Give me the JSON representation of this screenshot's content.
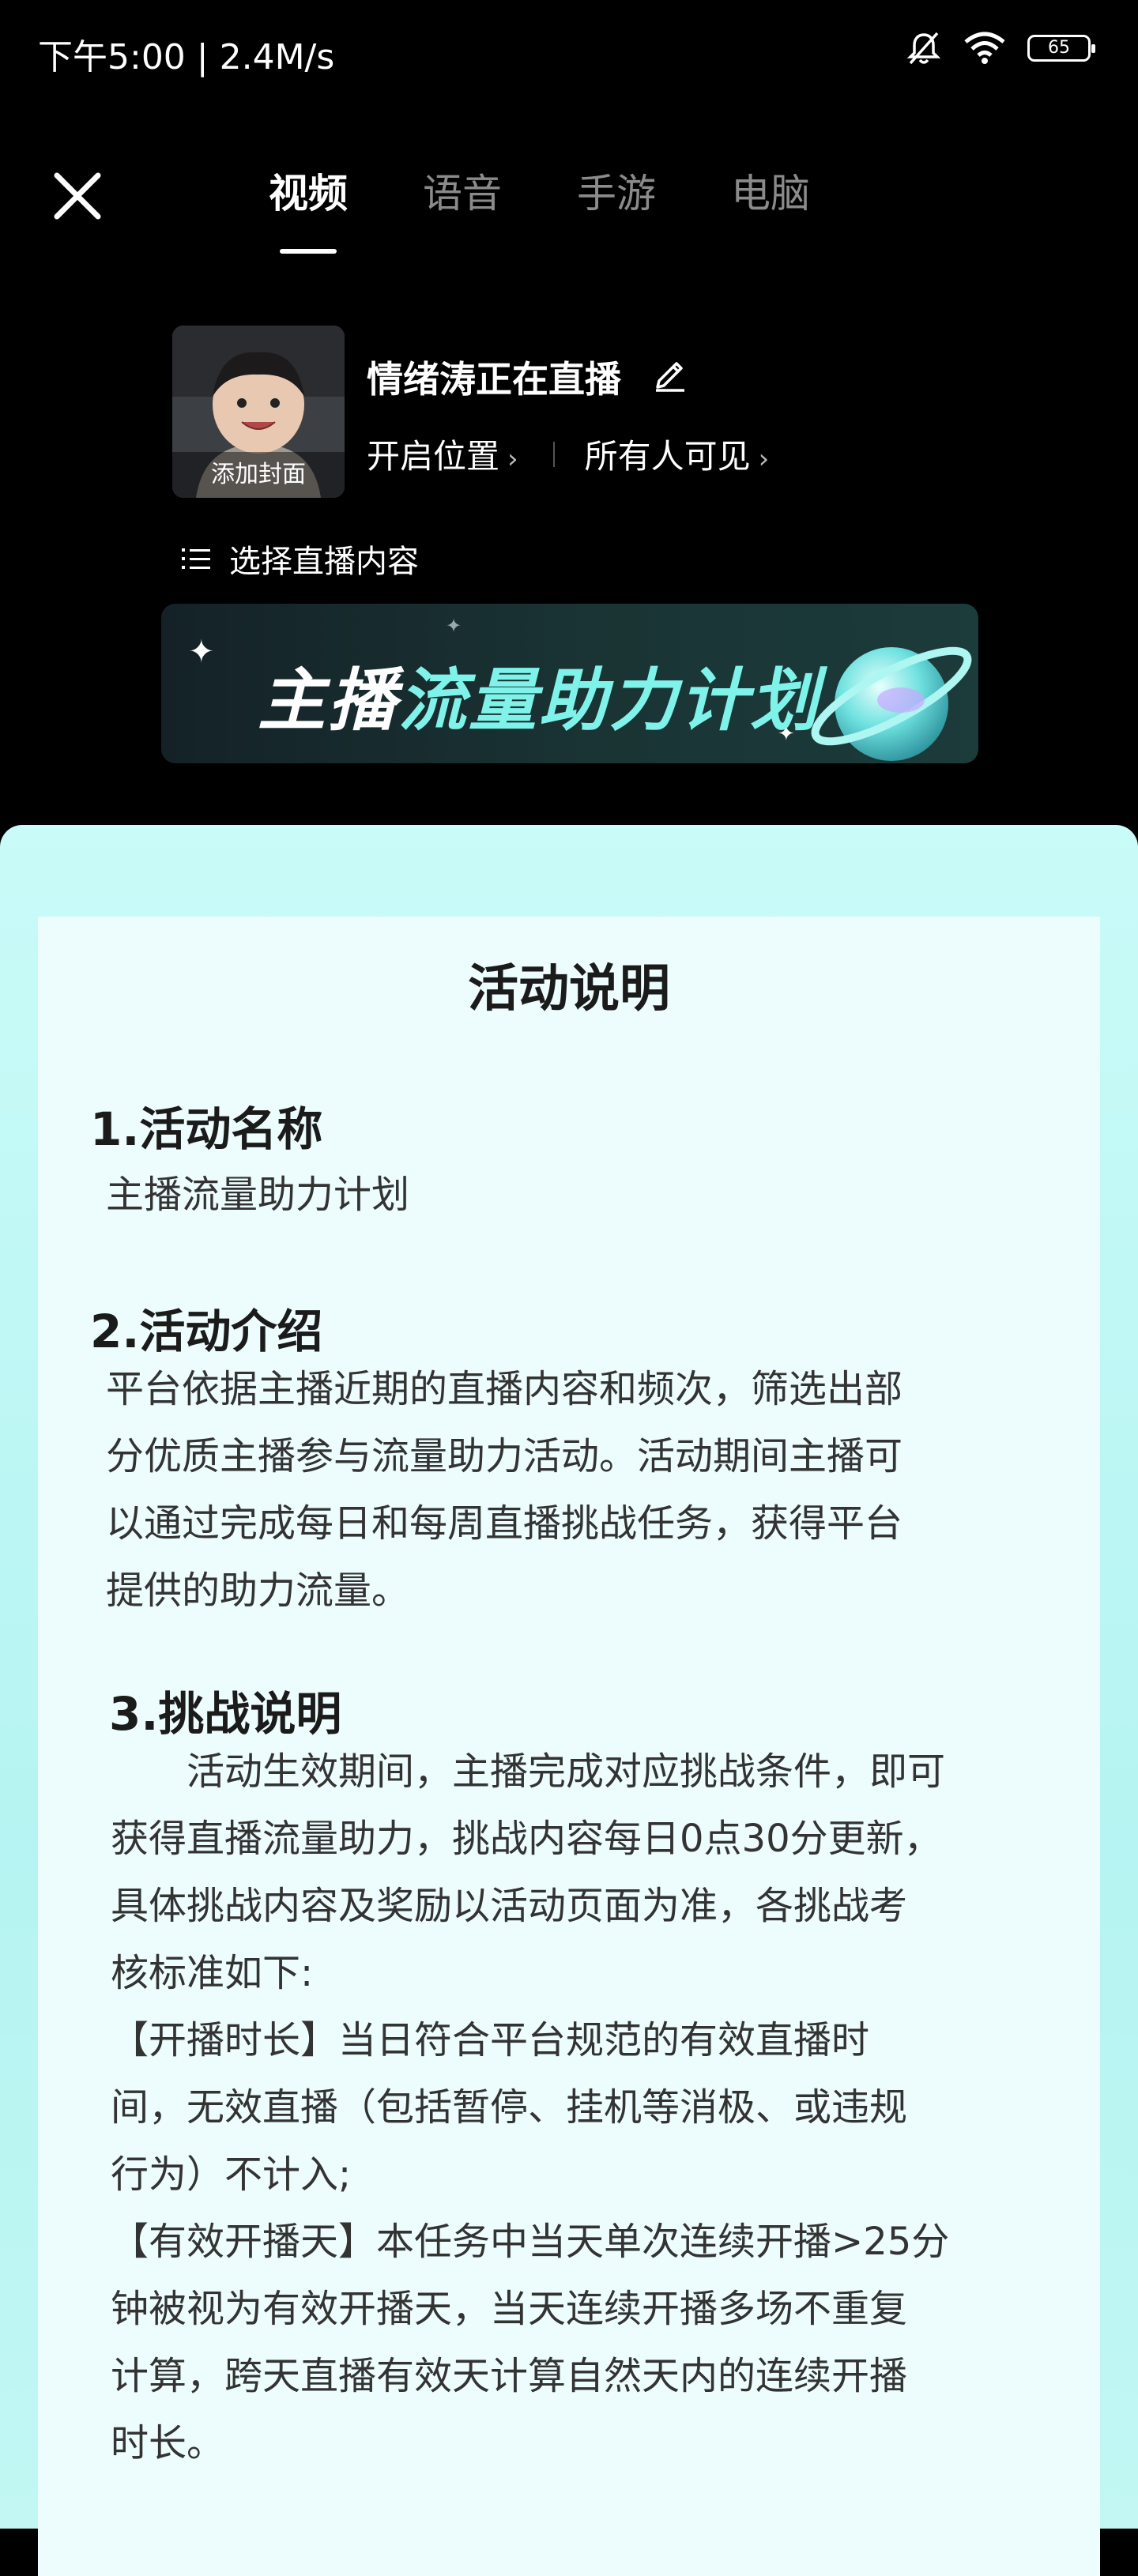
{
  "status_bar": {
    "time": "下午5:00 | 2.4M/s",
    "battery": "65"
  },
  "header": {
    "tabs": [
      "视频",
      "语音",
      "手游",
      "电脑"
    ]
  },
  "stream": {
    "cover_label": "添加封面",
    "title": "情绪涛正在直播",
    "location": "开启位置",
    "visibility": "所有人可见",
    "select_content": "选择直播内容"
  },
  "banner": {
    "text_white": "主播",
    "text_cyan": "流量助力计划"
  },
  "panel": {
    "title": "活动说明",
    "section1_heading": "1.活动名称",
    "section1_body": "主播流量助力计划",
    "section2_heading": "2.活动介绍",
    "section2_lines": [
      "平台依据主播近期的直播内容和频次，筛选出部",
      "分优质主播参与流量助力活动。活动期间主播可",
      "以通过完成每日和每周直播挑战任务，获得平台",
      "提供的助力流量。"
    ],
    "section3_heading": "3.挑战说明",
    "section3_lines": [
      "　　活动生效期间，主播完成对应挑战条件，即可",
      "获得直播流量助力，挑战内容每日0点30分更新，",
      "具体挑战内容及奖励以活动页面为准，各挑战考",
      "核标准如下:",
      "【开播时长】当日符合平台规范的有效直播时",
      "间，无效直播（包括暂停、挂机等消极、或违规",
      "行为）不计入;",
      "【有效开播天】本任务中当天单次连续开播>25分",
      "钟被视为有效开播天，当天连续开播多场不重复",
      "计算，跨天直播有效天计算自然天内的连续开播",
      "时长。"
    ]
  },
  "icons": {
    "close": "close-icon",
    "edit": "pencil-icon",
    "list": "list-icon",
    "mute": "bell-off-icon",
    "wifi": "wifi-icon",
    "battery": "battery-icon"
  },
  "colors": {
    "accent_cyan": "#7ff3ea",
    "panel_bg": "#b5f4f2",
    "card_bg": "#edfcfc"
  }
}
